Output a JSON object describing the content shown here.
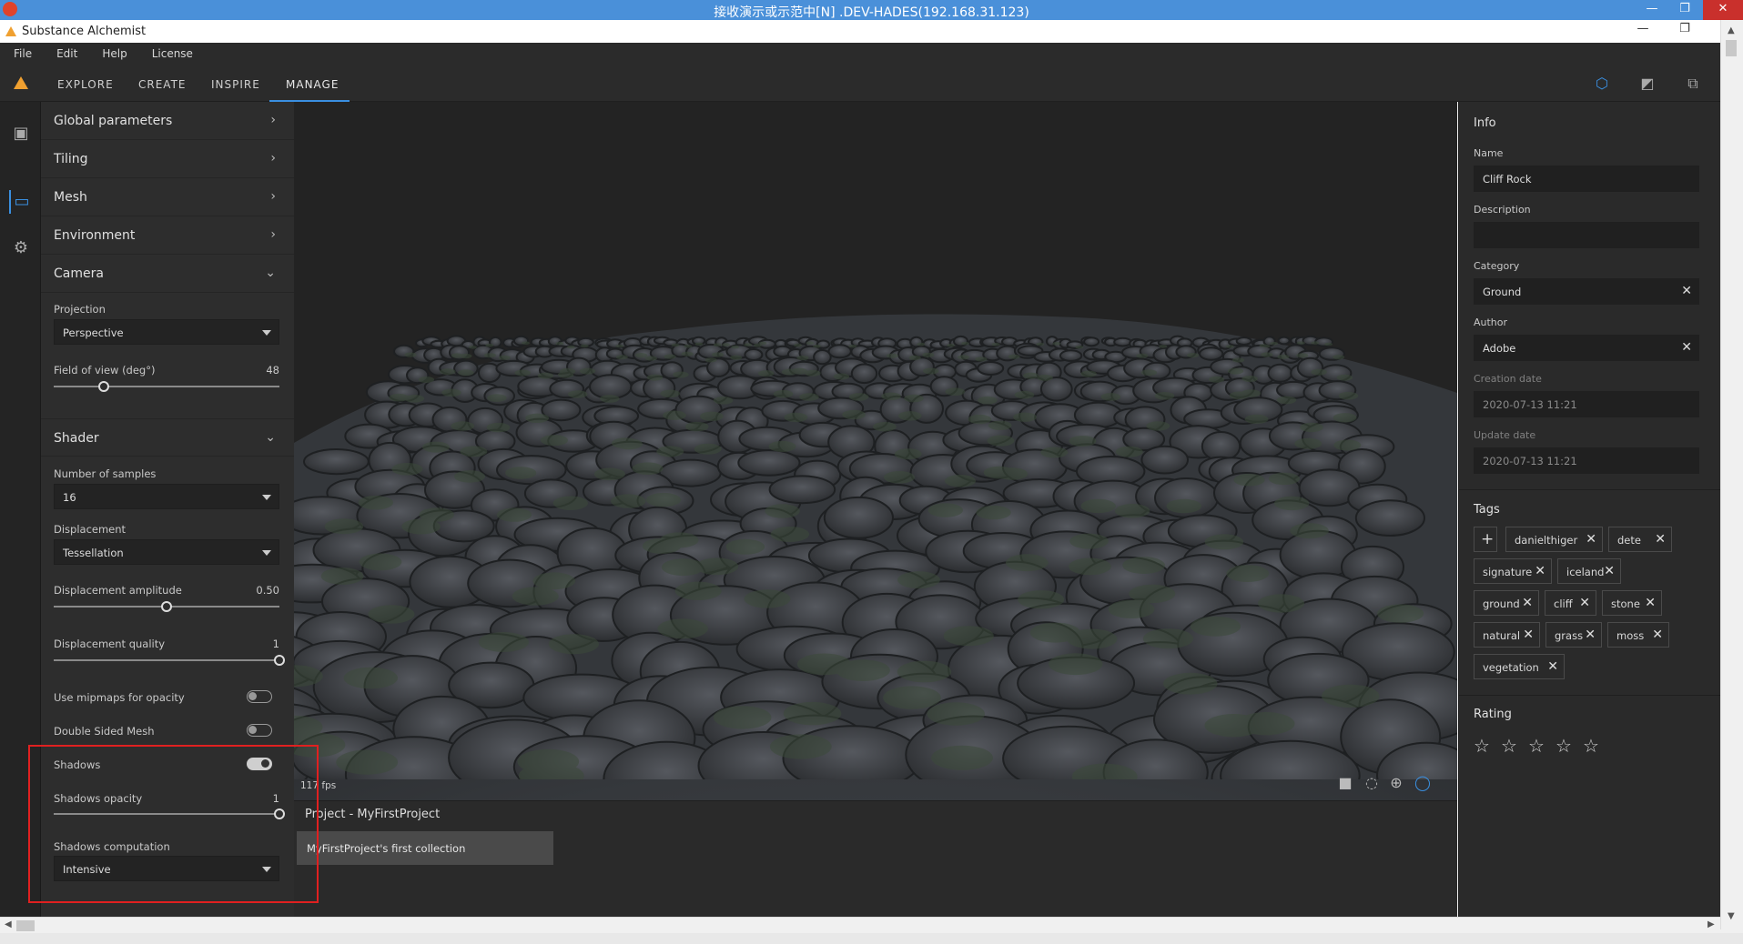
{
  "remote": {
    "title": "接收演示或示范中[N] .DEV-HADES(192.168.31.123)",
    "minimize": "—",
    "restore": "❐",
    "close": "✕"
  },
  "app": {
    "title": "Substance Alchemist",
    "minimize": "—",
    "restore": "❐"
  },
  "menu": [
    "File",
    "Edit",
    "Help",
    "License"
  ],
  "nav": {
    "tabs": [
      "EXPLORE",
      "CREATE",
      "INSPIRE",
      "MANAGE"
    ],
    "active_tab": "MANAGE"
  },
  "params": {
    "sections": {
      "global": "Global parameters",
      "tiling": "Tiling",
      "mesh": "Mesh",
      "environment": "Environment",
      "camera": "Camera",
      "shader": "Shader"
    },
    "camera": {
      "projection_label": "Projection",
      "projection_value": "Perspective",
      "fov_label": "Field of view (deg°)",
      "fov_value": "48",
      "fov_fraction": 0.22
    },
    "shader": {
      "samples_label": "Number of samples",
      "samples_value": "16",
      "displacement_label": "Displacement",
      "displacement_value": "Tessellation",
      "amp_label": "Displacement amplitude",
      "amp_value": "0.50",
      "amp_fraction": 0.5,
      "quality_label": "Displacement quality",
      "quality_value": "1",
      "quality_fraction": 1.0,
      "mipmaps_label": "Use mipmaps for opacity",
      "mipmaps_on": false,
      "double_sided_label": "Double Sided Mesh",
      "double_sided_on": false,
      "shadows_label": "Shadows",
      "shadows_on": true,
      "shadows_opacity_label": "Shadows opacity",
      "shadows_opacity_value": "1",
      "shadows_opacity_fraction": 1.0,
      "shadows_comp_label": "Shadows computation",
      "shadows_comp_value": "Intensive"
    }
  },
  "viewport": {
    "fps": "117 fps"
  },
  "project": {
    "title": "Project - MyFirstProject",
    "collection": "MyFirstProject's first collection"
  },
  "info": {
    "title": "Info",
    "name_label": "Name",
    "name_value": "Cliff Rock",
    "description_label": "Description",
    "description_value": "",
    "category_label": "Category",
    "category_value": "Ground",
    "author_label": "Author",
    "author_value": "Adobe",
    "creation_label": "Creation date",
    "creation_value": "2020-07-13 11:21",
    "update_label": "Update date",
    "update_value": "2020-07-13 11:21",
    "tags_title": "Tags",
    "tags": [
      "danielthiger",
      "dete",
      "signature",
      "iceland",
      "ground",
      "cliff",
      "stone",
      "natural",
      "grass",
      "moss",
      "vegetation"
    ],
    "rating_title": "Rating",
    "rating_value": 0,
    "rating_max": 5
  },
  "colors": {
    "accent": "#3a8fe0",
    "highlight": "#e02020",
    "panel": "#2d2d2d"
  }
}
